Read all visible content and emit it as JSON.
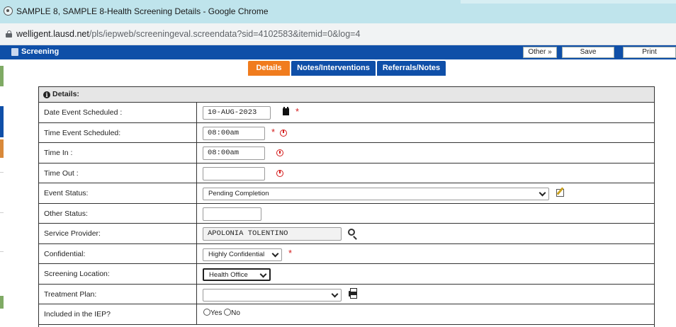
{
  "browser": {
    "window_title": "SAMPLE 8, SAMPLE 8-Health Screening Details - Google Chrome",
    "url_host": "welligent.lausd.net",
    "url_path": "/pls/iepweb/screeningeval.screendata?sid=4102583&itemid=0&log=4"
  },
  "appbar": {
    "title": "Screening",
    "other_label": "Other »",
    "save_label": "Save",
    "print_label": "Print"
  },
  "tabs": [
    {
      "label": "Details",
      "active": true
    },
    {
      "label": "Notes/Interventions",
      "active": false
    },
    {
      "label": "Referrals/Notes",
      "active": false
    }
  ],
  "panel": {
    "heading": "Details:"
  },
  "form": {
    "date_event_scheduled": {
      "label": "Date Event Scheduled :",
      "value": "10-AUG-2023"
    },
    "time_event_scheduled": {
      "label": "Time Event Scheduled:",
      "value": "08:00am"
    },
    "time_in": {
      "label": "Time In :",
      "value": "08:00am"
    },
    "time_out": {
      "label": "Time Out :",
      "value": ""
    },
    "event_status": {
      "label": "Event Status:",
      "value": "Pending Completion"
    },
    "other_status": {
      "label": "Other Status:",
      "value": ""
    },
    "service_provider": {
      "label": "Service Provider:",
      "value": "APOLONIA TOLENTINO"
    },
    "confidential": {
      "label": "Confidential:",
      "value": "Highly Confidential"
    },
    "screening_location": {
      "label": "Screening Location:",
      "value": "Health Office"
    },
    "treatment_plan": {
      "label": "Treatment Plan:",
      "value": ""
    },
    "included_in_iep": {
      "label": "Included in the IEP?",
      "yes_label": "Yes",
      "no_label": "No"
    }
  },
  "required_mark": "*",
  "colors": {
    "brand_blue": "#0f4fa8",
    "active_tab_orange": "#f07c1e",
    "required_red": "#d41b1b",
    "chrome_titlebar": "#bfe4ec"
  },
  "icons": {
    "calendar": "calendar-icon",
    "clock": "clock-icon",
    "edit": "edit-icon",
    "search": "search-icon",
    "print": "print-icon",
    "info": "info-icon",
    "lock": "lock-icon"
  }
}
